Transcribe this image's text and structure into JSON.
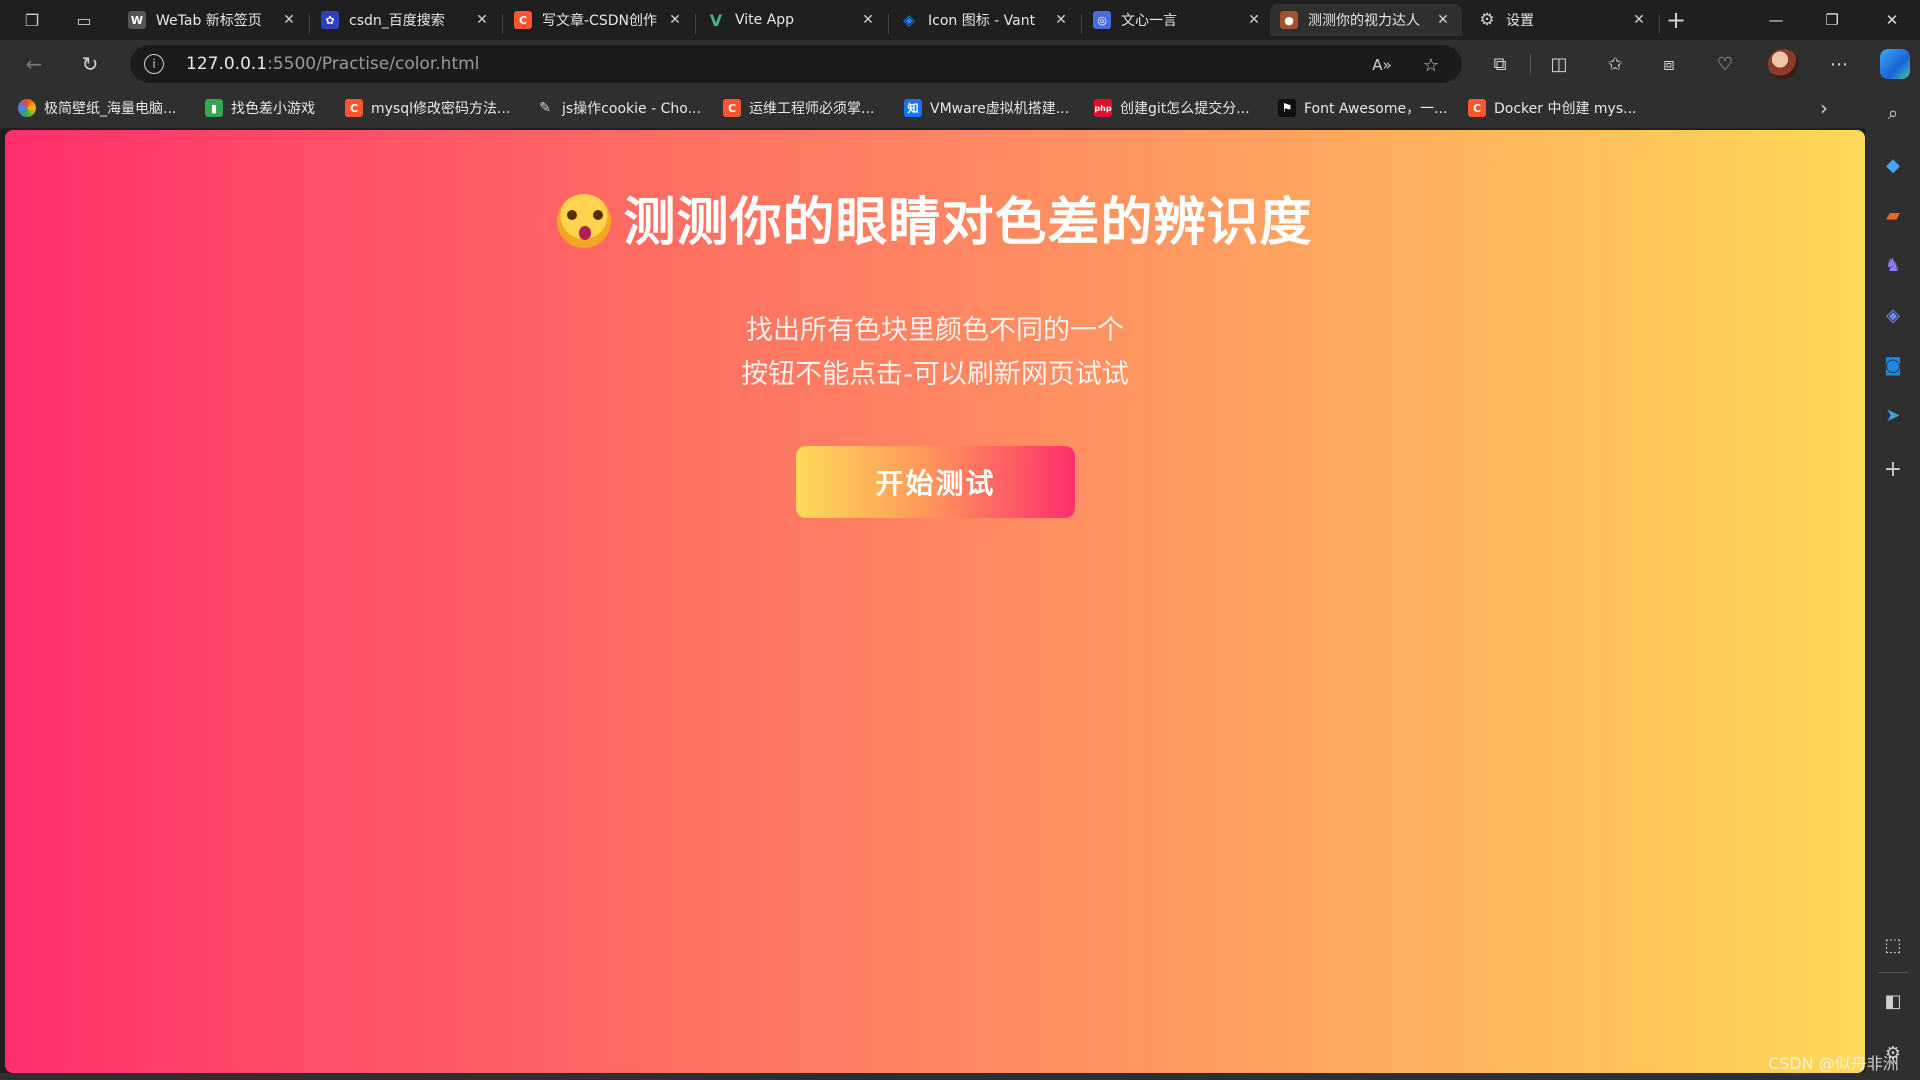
{
  "browser": {
    "tabs": [
      {
        "label": "WeTab 新标签页",
        "icon": "wetab-icon",
        "color": "#555555"
      },
      {
        "label": "csdn_百度搜索",
        "icon": "baidu-paw-icon",
        "color": "#2f3fbf"
      },
      {
        "label": "写文章-CSDN创作",
        "icon": "csdn-icon",
        "color": "#fc5531"
      },
      {
        "label": "Vite App",
        "icon": "vue-icon",
        "color": "#41b883"
      },
      {
        "label": "Icon 图标 - Vant",
        "icon": "vant-icon",
        "color": "#1989fa"
      },
      {
        "label": "文心一言",
        "icon": "wenxin-icon",
        "color": "#4a6bdf"
      },
      {
        "label": "测测你的视力达人",
        "icon": "page-avatar-icon",
        "color": "#a0522d"
      },
      {
        "label": "设置",
        "icon": "settings-icon",
        "color": "#2f2f2f"
      }
    ],
    "new_tab_symbol": "+",
    "address": {
      "host": "127.0.0.1",
      "path": ":5500/Practise/color.html"
    },
    "bookmarks": [
      {
        "label": "极简壁纸_海量电脑...",
        "icon": "bizhi-icon",
        "color": "#e34c26"
      },
      {
        "label": "找色差小游戏",
        "icon": "game-icon",
        "color": "#34a853"
      },
      {
        "label": "mysql修改密码方法...",
        "icon": "csdn-icon",
        "color": "#fc5531"
      },
      {
        "label": "js操作cookie - Cho...",
        "icon": "cookie-icon",
        "color": "#777777"
      },
      {
        "label": "运维工程师必须掌...",
        "icon": "csdn-icon",
        "color": "#fc5531"
      },
      {
        "label": "VMware虚拟机搭建...",
        "icon": "zhihu-icon",
        "color": "#1772f6"
      },
      {
        "label": "创建git怎么提交分...",
        "icon": "php-icon",
        "color": "#e0102b"
      },
      {
        "label": "Font Awesome，一...",
        "icon": "font-awesome-icon",
        "color": "#111111"
      },
      {
        "label": "Docker 中创建 mys...",
        "icon": "csdn-icon",
        "color": "#fc5531"
      }
    ]
  },
  "page": {
    "title": "测测你的眼睛对色差的辨识度",
    "subtitle_line1": "找出所有色块里颜色不同的一个",
    "subtitle_line2": "按钮不能点击-可以刷新网页试试",
    "start_button": "开始测试"
  },
  "watermark": "CSDN @似舟非洲",
  "colors": {
    "gradient_start": "#ff2f6c",
    "gradient_end": "#ffd957",
    "chrome_bg": "#2f2f2f"
  }
}
